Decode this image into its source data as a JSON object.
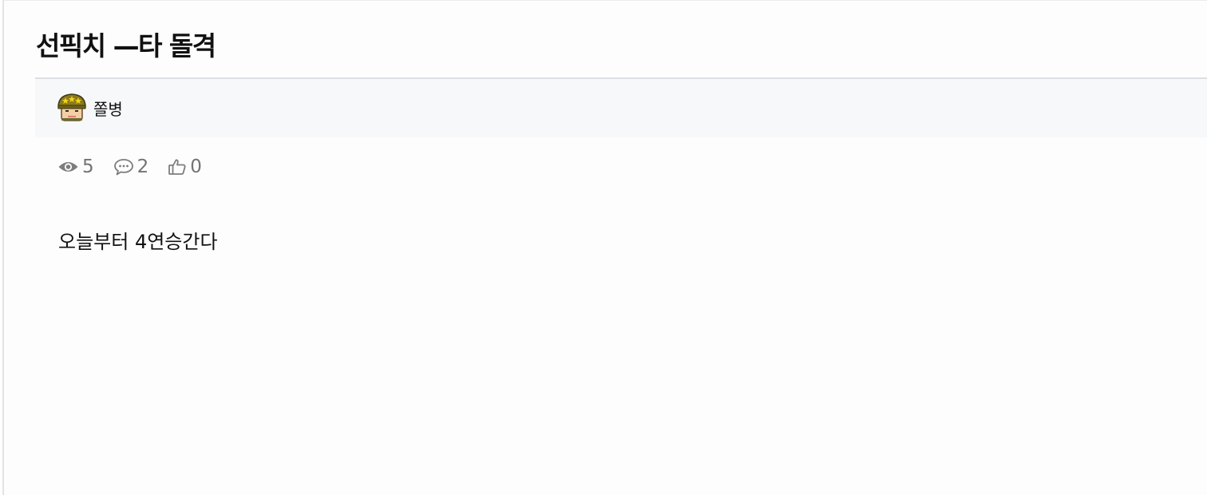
{
  "post": {
    "title": "선픽치 —타 돌격",
    "author": {
      "name": "쫄병",
      "avatar_icon": "soldier-helmet-avatar"
    },
    "stats": {
      "views": "5",
      "comments": "2",
      "likes": "0"
    },
    "body": "오늘부터 4연승간다"
  },
  "colors": {
    "panel_background": "#fdfdfd",
    "author_bar_background": "#f7f8fa",
    "divider": "#dcdee2",
    "title_text": "#111111",
    "stat_text": "#737373",
    "helmet": "#8a7a1e",
    "helmet_star": "#f2d21b"
  },
  "icons": {
    "views": "eye-icon",
    "comments": "speech-bubble-icon",
    "likes": "thumbs-up-icon"
  }
}
